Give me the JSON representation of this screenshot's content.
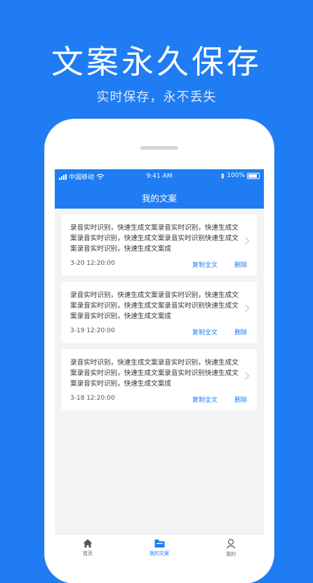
{
  "banner": {
    "title": "文案永久保存",
    "subtitle": "实时保存，永不丢失"
  },
  "status_bar": {
    "carrier": "中国移动",
    "time": "9:41 AM",
    "battery": "100%"
  },
  "app": {
    "title": "我的文案"
  },
  "cards": [
    {
      "text": "录音实时识别，快速生成文案录音实时识别，快速生成文案录音实时识别，快速生成文案录音实时识别快速生成文案录音实时识别，快速生成文案成",
      "time": "3-20 12:20:00",
      "copy_label": "复制全文",
      "delete_label": "删除"
    },
    {
      "text": "录音实时识别，快速生成文案录音实时识别，快速生成文案录音实时识别，快速生成文案录音实时识别快速生成文案录音实时识别，快速生成文案成",
      "time": "3-19 12:20:00",
      "copy_label": "复制全文",
      "delete_label": "删除"
    },
    {
      "text": "录音实时识别，快速生成文案录音实时识别，快速生成文案录音实时识别，快速生成文案录音实时识别快速生成文案录音实时识别，快速生成文案成",
      "time": "3-18 12:20:00",
      "copy_label": "复制全文",
      "delete_label": "删除"
    }
  ],
  "tabbar": {
    "home": "首页",
    "docs": "我的文案",
    "mine": "我的"
  },
  "colors": {
    "brand": "#1f7cf2",
    "background": "#f2f3f5"
  }
}
